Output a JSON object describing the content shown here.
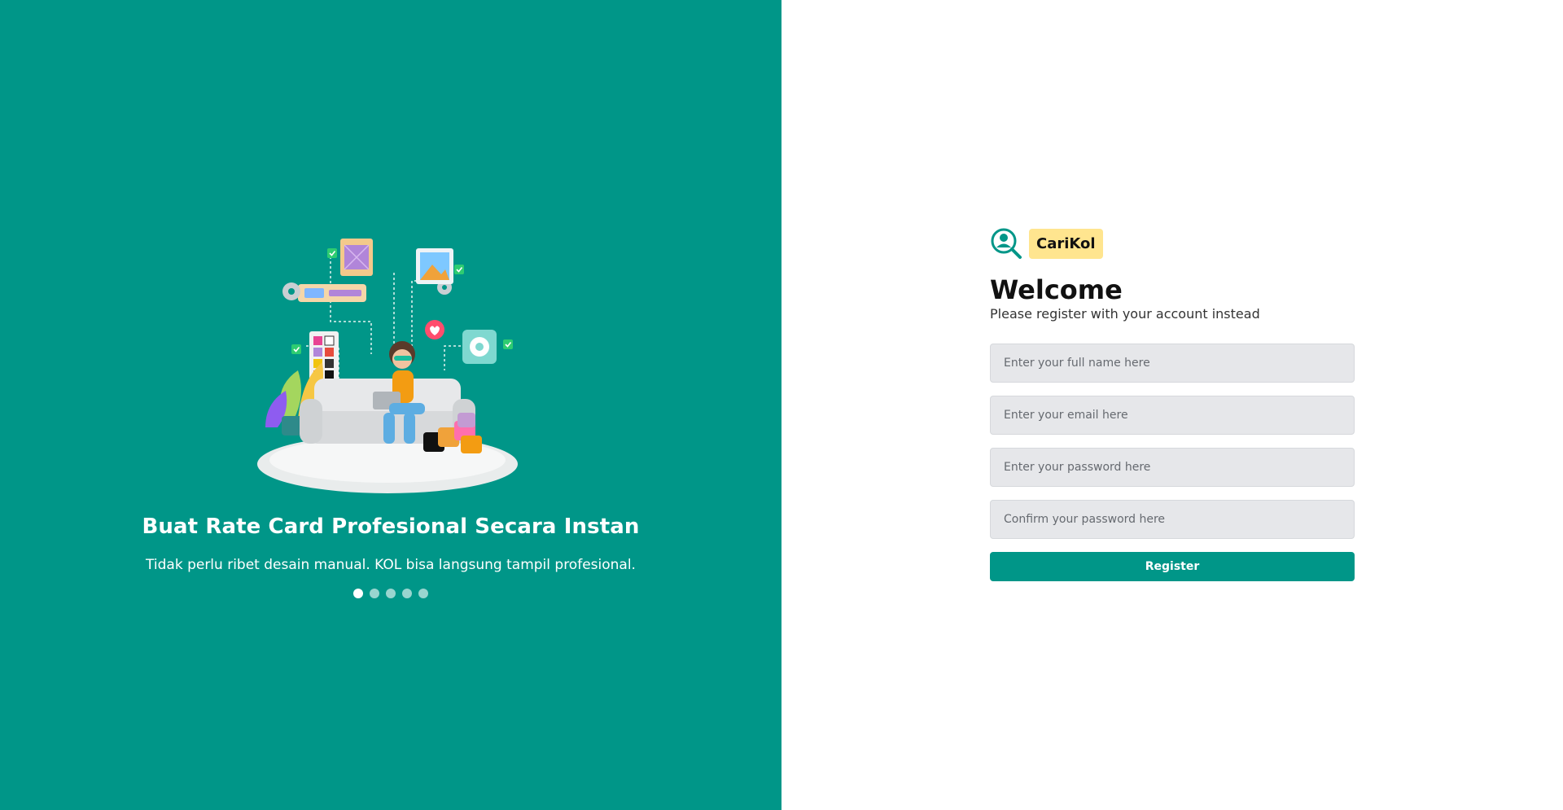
{
  "carousel": {
    "title": "Buat Rate Card Profesional Secara Instan",
    "description": "Tidak perlu ribet desain manual. KOL bisa langsung tampil profesional.",
    "slide_count": 5,
    "active_slide": 1
  },
  "brand": {
    "name": "CariKol",
    "icon": "user-search-icon"
  },
  "form": {
    "heading": "Welcome",
    "subtitle": "Please register with your account instead",
    "fullname_placeholder": "Enter your full name here",
    "email_placeholder": "Enter your email here",
    "password_placeholder": "Enter your password here",
    "confirm_placeholder": "Confirm your password here",
    "register_label": "Register"
  },
  "colors": {
    "primary": "#009688",
    "brand_badge": "#ffe58f",
    "input_bg": "#e6e7ea"
  }
}
